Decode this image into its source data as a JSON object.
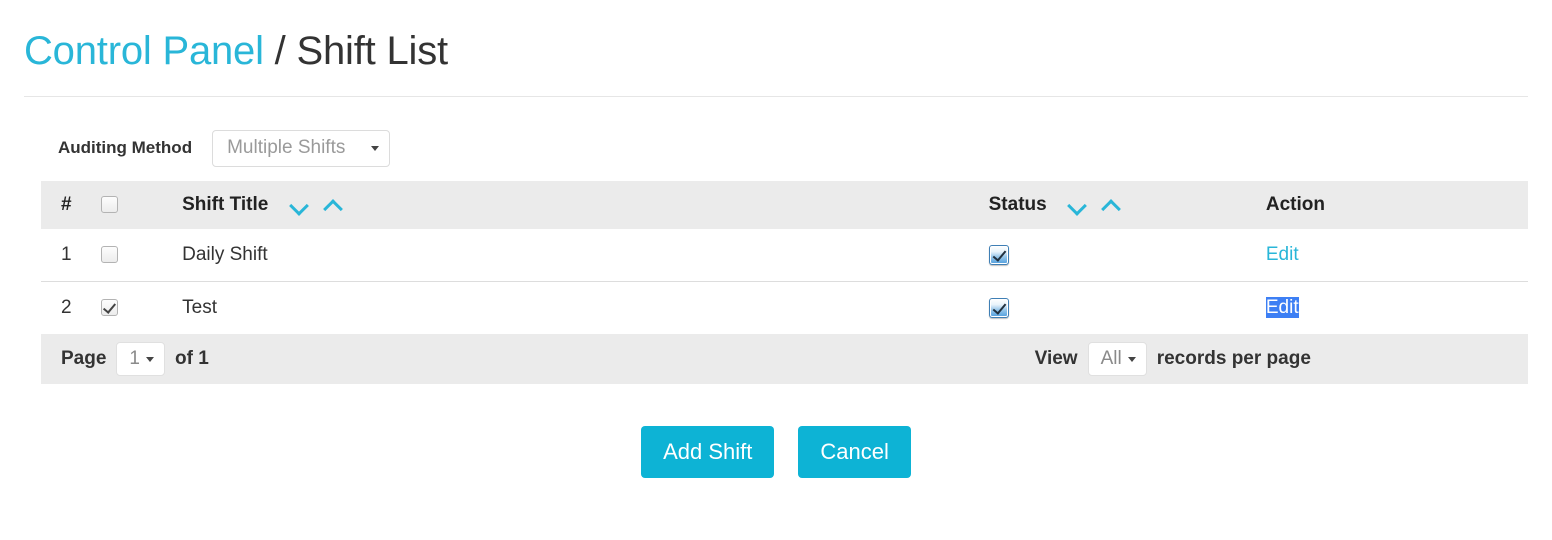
{
  "header": {
    "breadcrumb_link": "Control Panel",
    "breadcrumb_separator": "/",
    "breadcrumb_current": "Shift List"
  },
  "filter": {
    "label": "Auditing Method",
    "auditing_method": {
      "selected": "Multiple Shifts",
      "options": [
        "Multiple Shifts"
      ]
    }
  },
  "table": {
    "columns": {
      "number": "#",
      "select_all": "",
      "title": "Shift Title",
      "status": "Status",
      "action": "Action"
    },
    "rows": [
      {
        "number": "1",
        "selected": false,
        "title": "Daily Shift",
        "status_active": true,
        "action": "Edit",
        "action_selected": false
      },
      {
        "number": "2",
        "selected": true,
        "title": "Test",
        "status_active": true,
        "action": "Edit",
        "action_selected": true
      }
    ],
    "select_all_checked": false
  },
  "pager": {
    "page_label": "Page",
    "page_value": "1",
    "page_options": [
      "1"
    ],
    "of_label": "of 1",
    "view_label": "View",
    "view_value": "All",
    "view_options": [
      "All"
    ],
    "records_label": "records per page"
  },
  "buttons": {
    "add": "Add Shift",
    "cancel": "Cancel"
  },
  "colors": {
    "accent": "#29b6d8",
    "button": "#0db3d5",
    "header_row": "#ebebeb",
    "selection": "#3d7ff4"
  }
}
